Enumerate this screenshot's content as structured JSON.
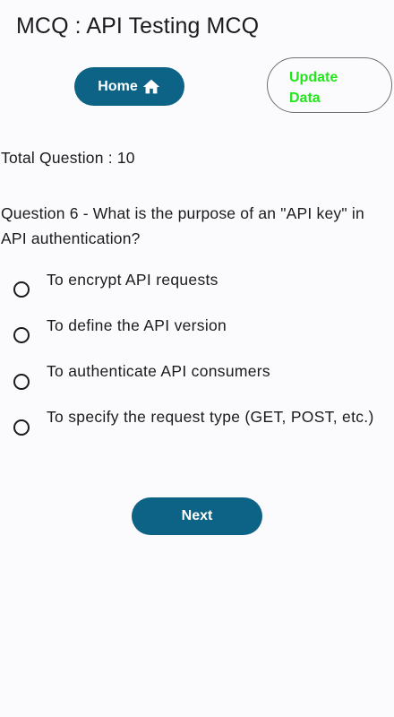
{
  "header": {
    "title": "MCQ : API Testing MCQ"
  },
  "actions": {
    "home_label": "Home",
    "home_icon": "home-icon",
    "update_label": "Update Data",
    "update_color": "#22e61c",
    "accent_color": "#0d6386"
  },
  "quiz": {
    "total_label": "Total Question : 10",
    "question": "Question 6 -  What is the purpose of an \"API key\" in API authentication?",
    "options": [
      {
        "label": "To encrypt API requests",
        "selected": false
      },
      {
        "label": "To define the API version",
        "selected": false
      },
      {
        "label": "To authenticate API consumers",
        "selected": false
      },
      {
        "label": "To specify the request type (GET, POST, etc.)",
        "selected": false
      }
    ],
    "next_label": "Next"
  }
}
